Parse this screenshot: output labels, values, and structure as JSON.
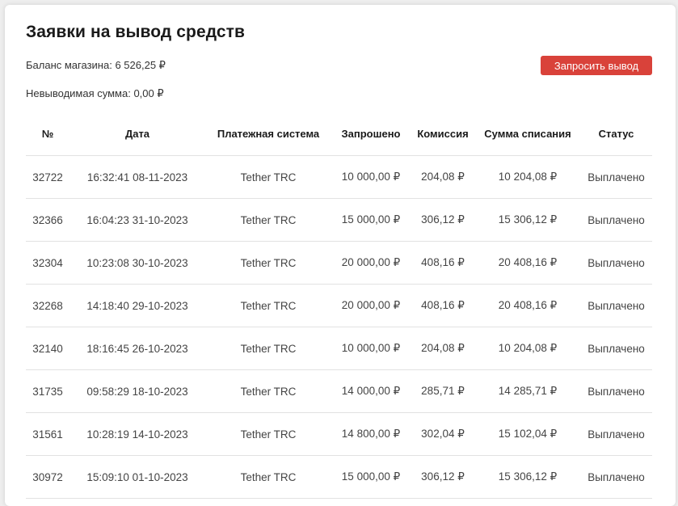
{
  "page": {
    "title": "Заявки на вывод средств",
    "balance_label": "Баланс магазина:",
    "balance_value": "6 526,25 ₽",
    "unwithdrawable_label": "Невыводимая сумма:",
    "unwithdrawable_value": "0,00 ₽",
    "request_button": "Запросить вывод"
  },
  "colors": {
    "accent_button": "#d9423a",
    "background": "#eeeeee",
    "card": "#ffffff"
  },
  "table": {
    "headers": [
      "№",
      "Дата",
      "Платежная система",
      "Запрошено",
      "Комиссия",
      "Сумма списания",
      "Статус"
    ],
    "rows": [
      [
        "32722",
        "16:32:41 08-11-2023",
        "Tether TRC",
        "10 000,00 ₽",
        "204,08 ₽",
        "10 204,08 ₽",
        "Выплачено"
      ],
      [
        "32366",
        "16:04:23 31-10-2023",
        "Tether TRC",
        "15 000,00 ₽",
        "306,12 ₽",
        "15 306,12 ₽",
        "Выплачено"
      ],
      [
        "32304",
        "10:23:08 30-10-2023",
        "Tether TRC",
        "20 000,00 ₽",
        "408,16 ₽",
        "20 408,16 ₽",
        "Выплачено"
      ],
      [
        "32268",
        "14:18:40 29-10-2023",
        "Tether TRC",
        "20 000,00 ₽",
        "408,16 ₽",
        "20 408,16 ₽",
        "Выплачено"
      ],
      [
        "32140",
        "18:16:45 26-10-2023",
        "Tether TRC",
        "10 000,00 ₽",
        "204,08 ₽",
        "10 204,08 ₽",
        "Выплачено"
      ],
      [
        "31735",
        "09:58:29 18-10-2023",
        "Tether TRC",
        "14 000,00 ₽",
        "285,71 ₽",
        "14 285,71 ₽",
        "Выплачено"
      ],
      [
        "31561",
        "10:28:19 14-10-2023",
        "Tether TRC",
        "14 800,00 ₽",
        "302,04 ₽",
        "15 102,04 ₽",
        "Выплачено"
      ],
      [
        "30972",
        "15:09:10 01-10-2023",
        "Tether TRC",
        "15 000,00 ₽",
        "306,12 ₽",
        "15 306,12 ₽",
        "Выплачено"
      ]
    ]
  }
}
